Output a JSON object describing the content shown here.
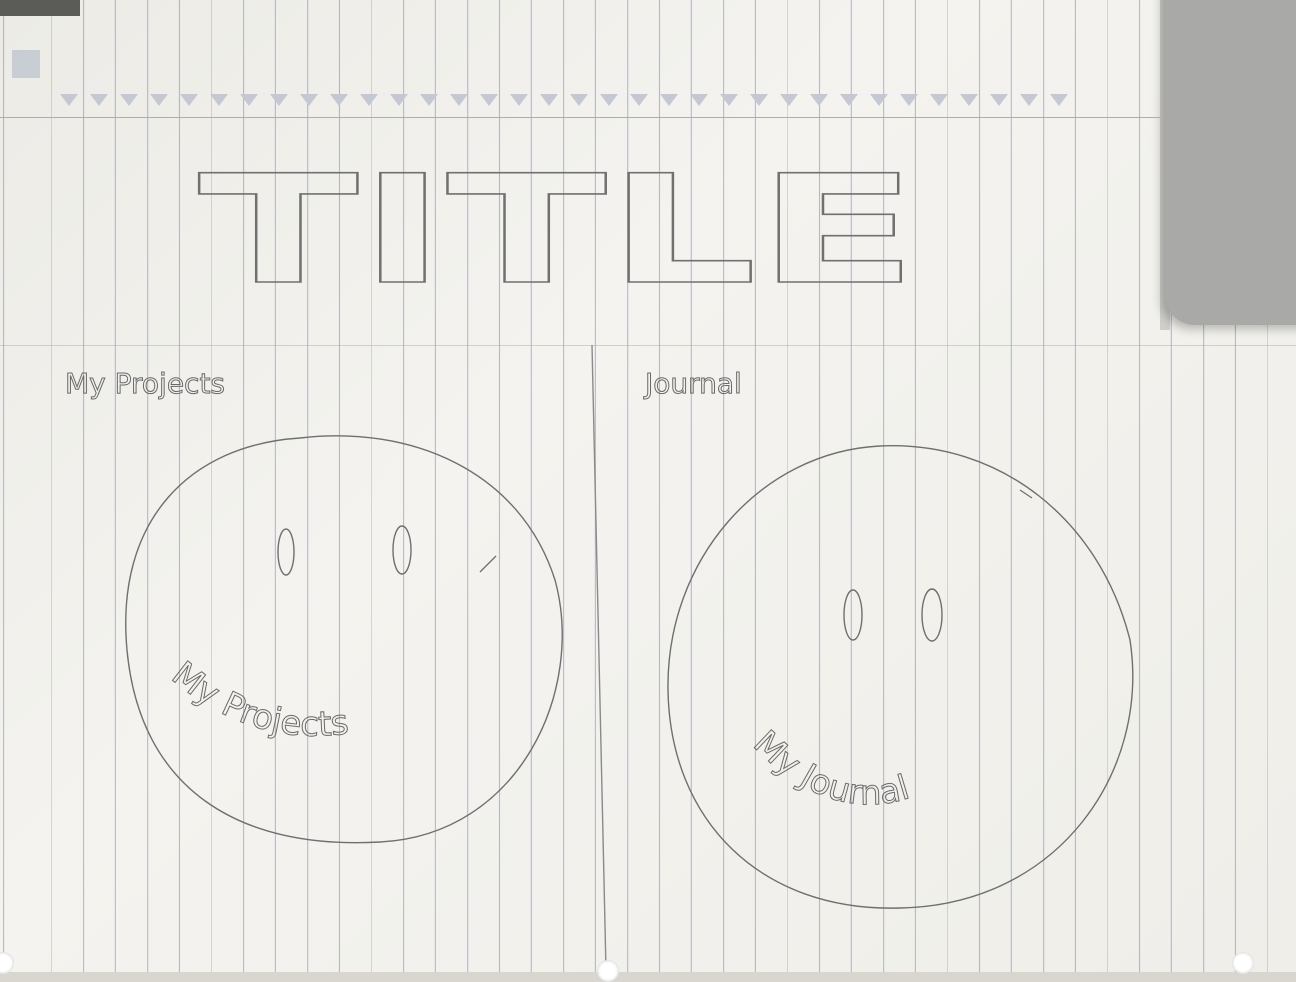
{
  "title": "TITLE",
  "sections": [
    {
      "label": "My Projects",
      "circle_label": "My Projects"
    },
    {
      "label": "Journal",
      "circle_label": "My Journal"
    }
  ],
  "colors": {
    "paper": "#f2f1ec",
    "rule_line": "#7f96c8",
    "margin_line": "#d99a9a",
    "pencil": "#6a6a6a"
  }
}
